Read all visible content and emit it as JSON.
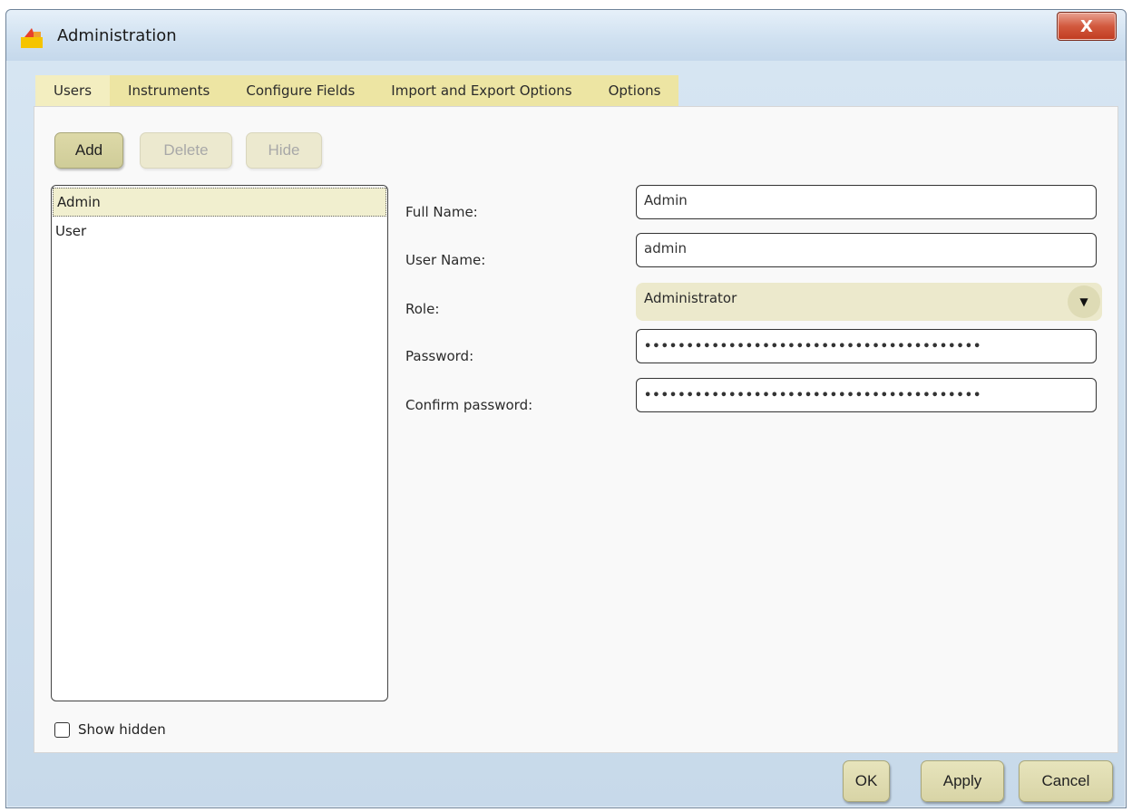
{
  "window": {
    "title": "Administration",
    "close_label": "X"
  },
  "tabs": [
    {
      "label": "Users"
    },
    {
      "label": "Instruments"
    },
    {
      "label": "Configure Fields"
    },
    {
      "label": "Import and Export Options"
    },
    {
      "label": "Options"
    }
  ],
  "toolbar": {
    "add_label": "Add",
    "delete_label": "Delete",
    "hide_label": "Hide"
  },
  "users": [
    {
      "name": "Admin",
      "selected": true
    },
    {
      "name": "User",
      "selected": false
    }
  ],
  "show_hidden": {
    "label": "Show hidden",
    "checked": false
  },
  "form": {
    "full_name_label": "Full Name:",
    "full_name_value": "Admin",
    "user_name_label": "User Name:",
    "user_name_value": "admin",
    "role_label": "Role:",
    "role_value": "Administrator",
    "password_label": "Password:",
    "password_value": "••••••••••••••••••••••••••••••••••••••••",
    "confirm_label": "Confirm password:",
    "confirm_value": "••••••••••••••••••••••••••••••••••••••••"
  },
  "footer": {
    "ok_label": "OK",
    "apply_label": "Apply",
    "cancel_label": "Cancel"
  },
  "colors": {
    "tab_bg": "#ede5a3",
    "button_bg": "#dcd8a6",
    "selection_bg": "#f1efcf"
  }
}
